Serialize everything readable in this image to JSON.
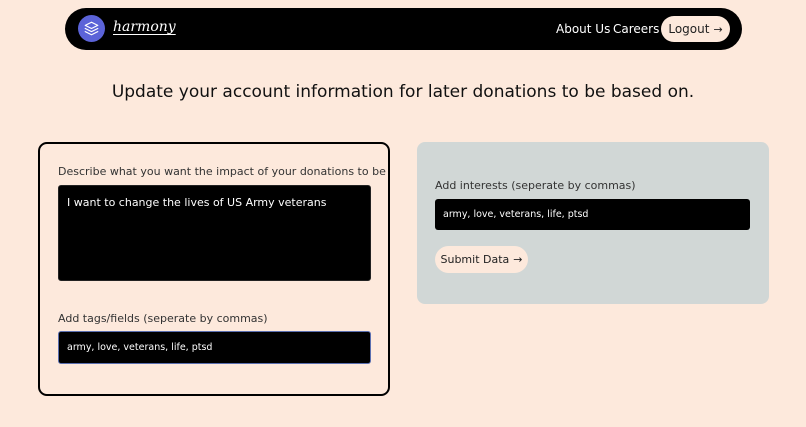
{
  "nav": {
    "brand": "harmony",
    "links": [
      "About Us",
      "Careers"
    ],
    "logout_label": "Logout",
    "arrow": "→"
  },
  "headline": "Update your account information for later donations to be based on.",
  "impact_form": {
    "label": "Describe what you want the impact of your donations to be",
    "value": "I want to change the lives of US Army veterans"
  },
  "tags_form": {
    "label": "Add tags/fields (seperate by commas)",
    "value": "army, love, veterans, life, ptsd"
  },
  "interests_form": {
    "label": "Add interests (seperate by commas)",
    "value": "army, love, veterans, life, ptsd",
    "submit_label": "Submit Data"
  },
  "colors": {
    "background": "#fde9dc",
    "navbar": "#000000",
    "logo_badge": "#5b63d8",
    "right_card": "#d1d7d6"
  },
  "icons": {
    "logo": "layers-icon",
    "arrow": "arrow-right-icon"
  }
}
